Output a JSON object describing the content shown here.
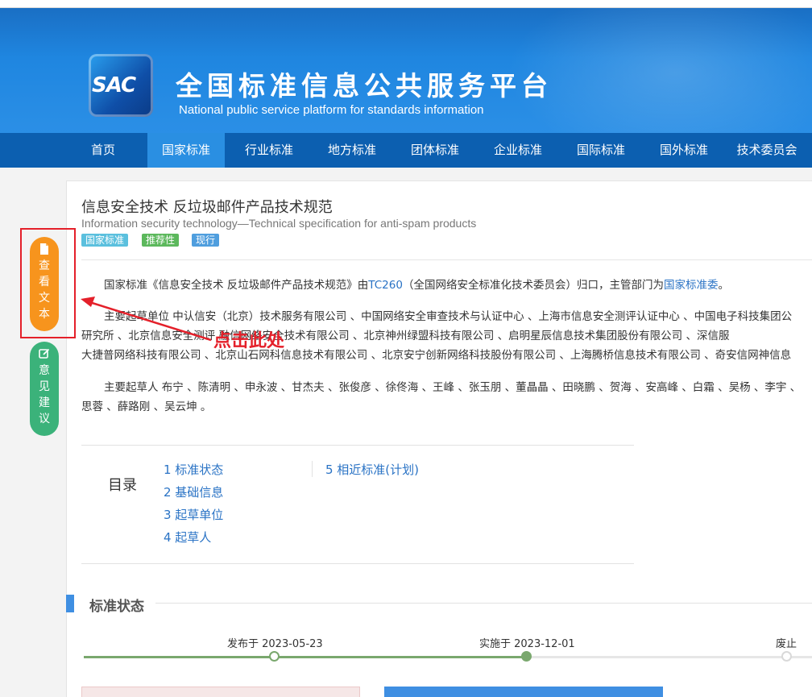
{
  "header": {
    "logo_text": "SAC",
    "title_cn": "全国标准信息公共服务平台",
    "title_en": "National public service platform  for standards information"
  },
  "nav": {
    "items": [
      {
        "label": "首页",
        "active": false
      },
      {
        "label": "国家标准",
        "active": true
      },
      {
        "label": "行业标准",
        "active": false
      },
      {
        "label": "地方标准",
        "active": false
      },
      {
        "label": "团体标准",
        "active": false
      },
      {
        "label": "企业标准",
        "active": false
      },
      {
        "label": "国际标准",
        "active": false
      },
      {
        "label": "国外标准",
        "active": false
      },
      {
        "label": "技术委员会",
        "active": false
      }
    ]
  },
  "sidebar": {
    "view_text": {
      "icon": "document-icon",
      "label": [
        "查",
        "看",
        "文",
        "本"
      ]
    },
    "feedback": {
      "icon": "edit-icon",
      "label": [
        "意",
        "见",
        "建",
        "议"
      ]
    }
  },
  "annotation": {
    "label": "点击此处",
    "color": "#e4202a"
  },
  "standard": {
    "title_cn": "信息安全技术 反垃圾邮件产品技术规范",
    "title_en": "Information security technology—Technical specification for anti-spam products",
    "tags": [
      "国家标准",
      "推荐性",
      "现行"
    ],
    "intro": {
      "prefix": "国家标准《信息安全技术 反垃圾邮件产品技术规范》由",
      "tc_link": "TC260",
      "middle": "（全国网络安全标准化技术委员会）归口，主管部门为",
      "dept_link": "国家标准委",
      "suffix": "。"
    },
    "drafting_units": {
      "line1": "主要起草单位 中认信安（北京）技术服务有限公司 、中国网络安全审查技术与认证中心 、上海市信息安全测评认证中心 、中国电子科技集团公",
      "line2": "研究所 、北京信息安全测评                 融信网络安全技术有限公司 、北京神州绿盟科技有限公司 、启明星辰信息技术集团股份有限公司 、深信服",
      "line3": "大捷普网络科技有限公司 、北京山石网科信息技术有限公司 、北京安宁创新网络科技股份有限公司 、上海腾桥信息技术有限公司 、奇安信网神信息"
    },
    "drafters": {
      "line1": "主要起草人 布宁 、陈清明 、申永波 、甘杰夫 、张俊彦 、徐佟海 、王峰 、张玉朋 、董晶晶 、田晓鹏 、贺海 、安高峰 、白霜 、吴杨 、李宇 、",
      "line2": "思蓉 、薛路刚 、吴云坤 。"
    }
  },
  "toc": {
    "heading": "目录",
    "items": [
      "1  标准状态",
      "2  基础信息",
      "3  起草单位",
      "4  起草人",
      "5  相近标准(计划)"
    ]
  },
  "status_section": {
    "title": "标准状态",
    "timeline": {
      "published": "发布于 2023-05-23",
      "implemented": "实施于 2023-12-01",
      "abolished": "废止",
      "progress_percent": 61
    }
  },
  "colors": {
    "nav_bg": "#0c5fb0",
    "nav_active": "#2a8fe2",
    "link": "#2a73c5",
    "orange_button": "#f7941d",
    "green_button": "#3bb27a",
    "timeline_green": "#7aa86e"
  }
}
